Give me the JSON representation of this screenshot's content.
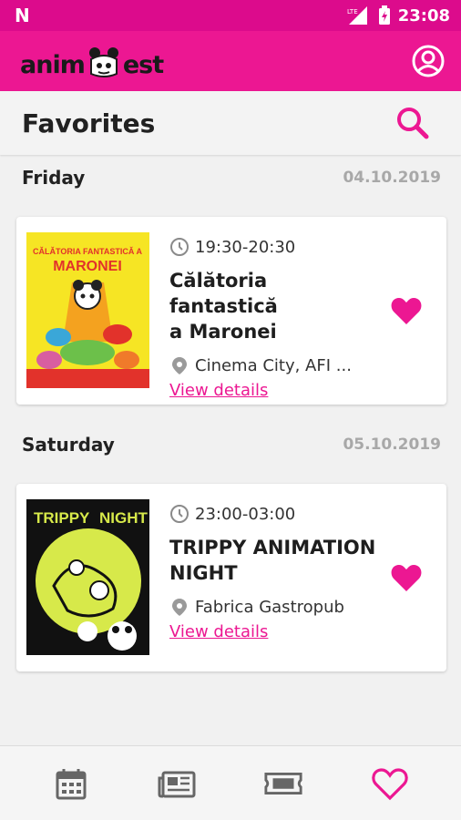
{
  "status_bar": {
    "network": "LTE",
    "time": "23:08"
  },
  "app": {
    "logo_left": "anim",
    "logo_right": "est"
  },
  "page": {
    "title": "Favorites"
  },
  "days": [
    {
      "day": "Friday",
      "date": "04.10.2019",
      "events": [
        {
          "time": "19:30-20:30",
          "title_line1": "Călătoria fantastică",
          "title_line2": "a Maronei",
          "location": "Cinema City, AFI ...",
          "details_label": "View details",
          "poster_text_1": "CĂLĂTORIA FANTASTICĂ A",
          "poster_text_2": "MARONEI"
        }
      ]
    },
    {
      "day": "Saturday",
      "date": "05.10.2019",
      "events": [
        {
          "time": "23:00-03:00",
          "title_line1": "TRIPPY ANIMATION",
          "title_line2": "NIGHT",
          "location": "Fabrica Gastropub",
          "details_label": "View details",
          "poster_text_1": "TRIPPY",
          "poster_text_2": "NIGHT"
        }
      ]
    }
  ],
  "bottom_nav": [
    "calendar-icon",
    "news-icon",
    "ticket-icon",
    "heart-icon"
  ],
  "colors": {
    "brand": "#ec1792",
    "status_bar": "#dc0b8c",
    "date": "#a8a8a8"
  }
}
